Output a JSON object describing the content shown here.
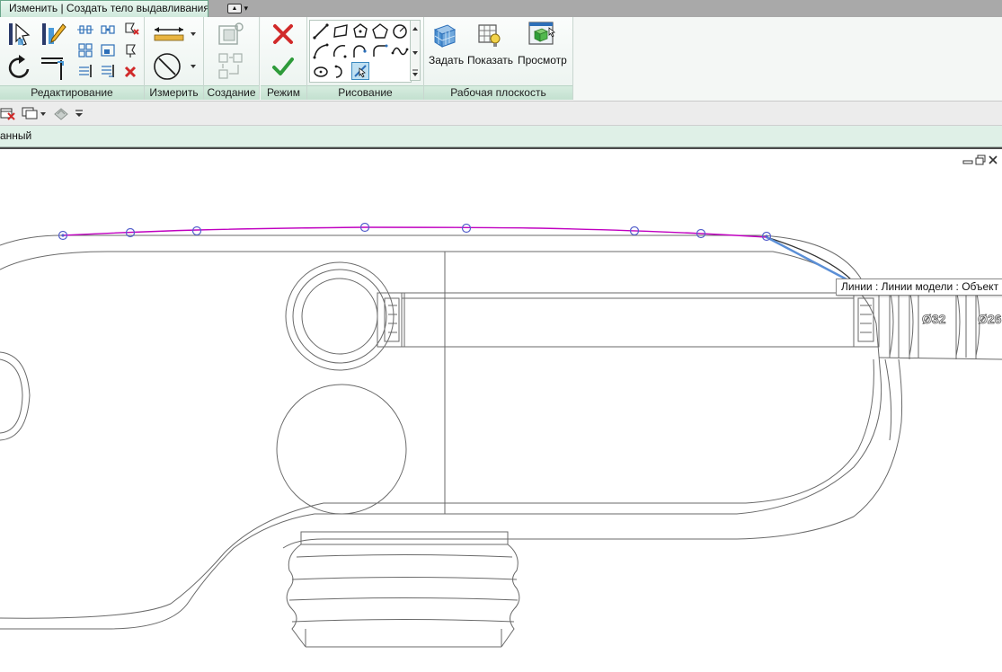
{
  "tabs": {
    "active_label": "Изменить | Создать тело выдавливания",
    "extra_label": "▲▾"
  },
  "ribbon": {
    "panels": {
      "edit": "Редактирование",
      "measure": "Измерить",
      "create": "Создание",
      "mode": "Режим",
      "draw": "Рисование",
      "workplane": "Рабочая плоскость"
    },
    "workplane_buttons": {
      "set": "Задать",
      "show": "Показать",
      "viewer": "Просмотр"
    }
  },
  "options_bar": {
    "text": "анный"
  },
  "canvas": {
    "tooltip": "Линии : Линии модели : Объект",
    "dimension_1": "Ø32",
    "dimension_2": "Ø26"
  },
  "colors": {
    "tab_active": "#d6efe1",
    "panel_label": "#c8e4d3",
    "sketch_line": "#c000c0",
    "highlight_line": "#5b8fd6",
    "control_point": "#5560cc",
    "finish_check": "#2e9b3a",
    "cancel_x": "#d12a2a"
  },
  "icons": [
    "modify-icon",
    "paste-icon",
    "copy-icon",
    "align-icon",
    "rotate-icon",
    "trim-icon",
    "array-icon",
    "scale-icon",
    "mirror-icon",
    "delete-icon",
    "dimension-icon",
    "measure-icon",
    "create-group-icon",
    "cancel-edit-icon",
    "finish-edit-icon",
    "line-icon",
    "rectangle-icon",
    "polygon-icon",
    "circle-icon",
    "arc-icon",
    "spline-icon",
    "pick-lines-icon",
    "workplane-set-icon",
    "workplane-show-icon",
    "workplane-viewer-icon"
  ]
}
